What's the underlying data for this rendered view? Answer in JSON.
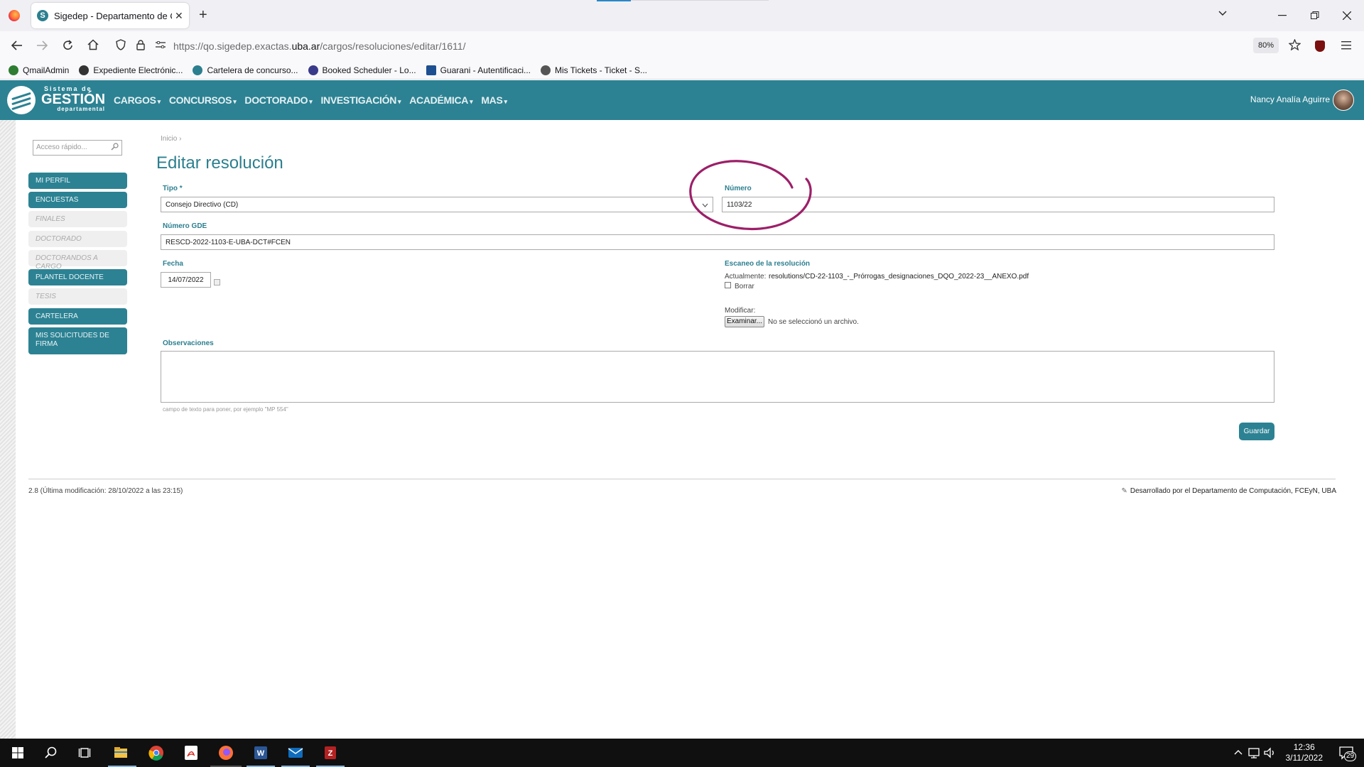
{
  "browser": {
    "tab_title": "Sigedep - Departamento de Qu",
    "tab_favicon": "S",
    "tab_close": "✕",
    "new_tab": "+",
    "url_prefix": "https://qo.sigedep.exactas.",
    "url_domain": "uba.ar",
    "url_path": "/cargos/resoluciones/editar/1611/",
    "zoom": "80%",
    "bookmarks": [
      {
        "label": "QmailAdmin",
        "icon": "qmail-icon",
        "color": "#2e7d32"
      },
      {
        "label": "Expediente Electrónic...",
        "icon": "expediente-icon",
        "color": "#333333"
      },
      {
        "label": "Cartelera de concurso...",
        "icon": "sigedep-icon",
        "color": "#2c7f8f"
      },
      {
        "label": "Booked Scheduler - Lo...",
        "icon": "booked-icon",
        "color": "#3a3a8a"
      },
      {
        "label": "Guarani - Autentificaci...",
        "icon": "siu-icon",
        "color": "#1d4f91"
      },
      {
        "label": "Mis Tickets - Ticket - S...",
        "icon": "ticket-icon",
        "color": "#555555"
      }
    ]
  },
  "app": {
    "logo_line1": "Sistema de",
    "logo_line2": "GESTIÓN",
    "logo_line3": "departamental",
    "menu": [
      {
        "label": "CARGOS"
      },
      {
        "label": "CONCURSOS"
      },
      {
        "label": "DOCTORADO"
      },
      {
        "label": "INVESTIGACIÓN"
      },
      {
        "label": "ACADÉMICA"
      },
      {
        "label": "MAS"
      }
    ],
    "caret": "▾",
    "user_name": "Nancy Analía Aguirre"
  },
  "sidebar": {
    "quick_placeholder": "Acceso rápido...",
    "items": [
      {
        "label": "MI PERFIL",
        "enabled": true
      },
      {
        "label": "ENCUESTAS",
        "enabled": true
      },
      {
        "label": "FINALES",
        "enabled": false
      },
      {
        "label": "DOCTORADO",
        "enabled": false
      },
      {
        "label": "DOCTORANDOS A CARGO",
        "enabled": false
      },
      {
        "label": "PLANTEL DOCENTE",
        "enabled": true
      },
      {
        "label": "TESIS",
        "enabled": false
      },
      {
        "label": "CARTELERA",
        "enabled": true
      },
      {
        "label": "MIS SOLICITUDES DE FIRMA",
        "enabled": true
      }
    ]
  },
  "form": {
    "breadcrumb": "Inicio ›",
    "title": "Editar resolución",
    "tipo_label": "Tipo *",
    "tipo_value": "Consejo Directivo (CD)",
    "numero_label": "Número",
    "numero_value": "1103/22",
    "gde_label": "Número GDE",
    "gde_value": "RESCD-2022-1103-E-UBA-DCT#FCEN",
    "fecha_label": "Fecha",
    "fecha_value": "14/07/2022",
    "escaneo_label": "Escaneo de la resolución",
    "actualmente_label": "Actualmente:",
    "actualmente_file": "resolutions/CD-22-1103_-_Prórrogas_designaciones_DQO_2022-23__ANEXO.pdf",
    "borrar_label": "Borrar",
    "modificar_label": "Modificar:",
    "examinar_label": "Examinar...",
    "no_file_label": "No se seleccionó un archivo.",
    "observaciones_label": "Observaciones",
    "observaciones_hint": "campo de texto para poner, por ejemplo \"MP 554\"",
    "save_label": "Guardar"
  },
  "footer": {
    "version": "2.8 (Última modificación: 28/10/2022 a las 23:15)",
    "credit": "Desarrollado por el Departamento de Computación, FCEyN, UBA"
  },
  "taskbar": {
    "time": "12:36",
    "date": "3/11/2022",
    "notifications": "29"
  },
  "colors": {
    "brand": "#2c8293",
    "annotation": "#9c1f68"
  }
}
